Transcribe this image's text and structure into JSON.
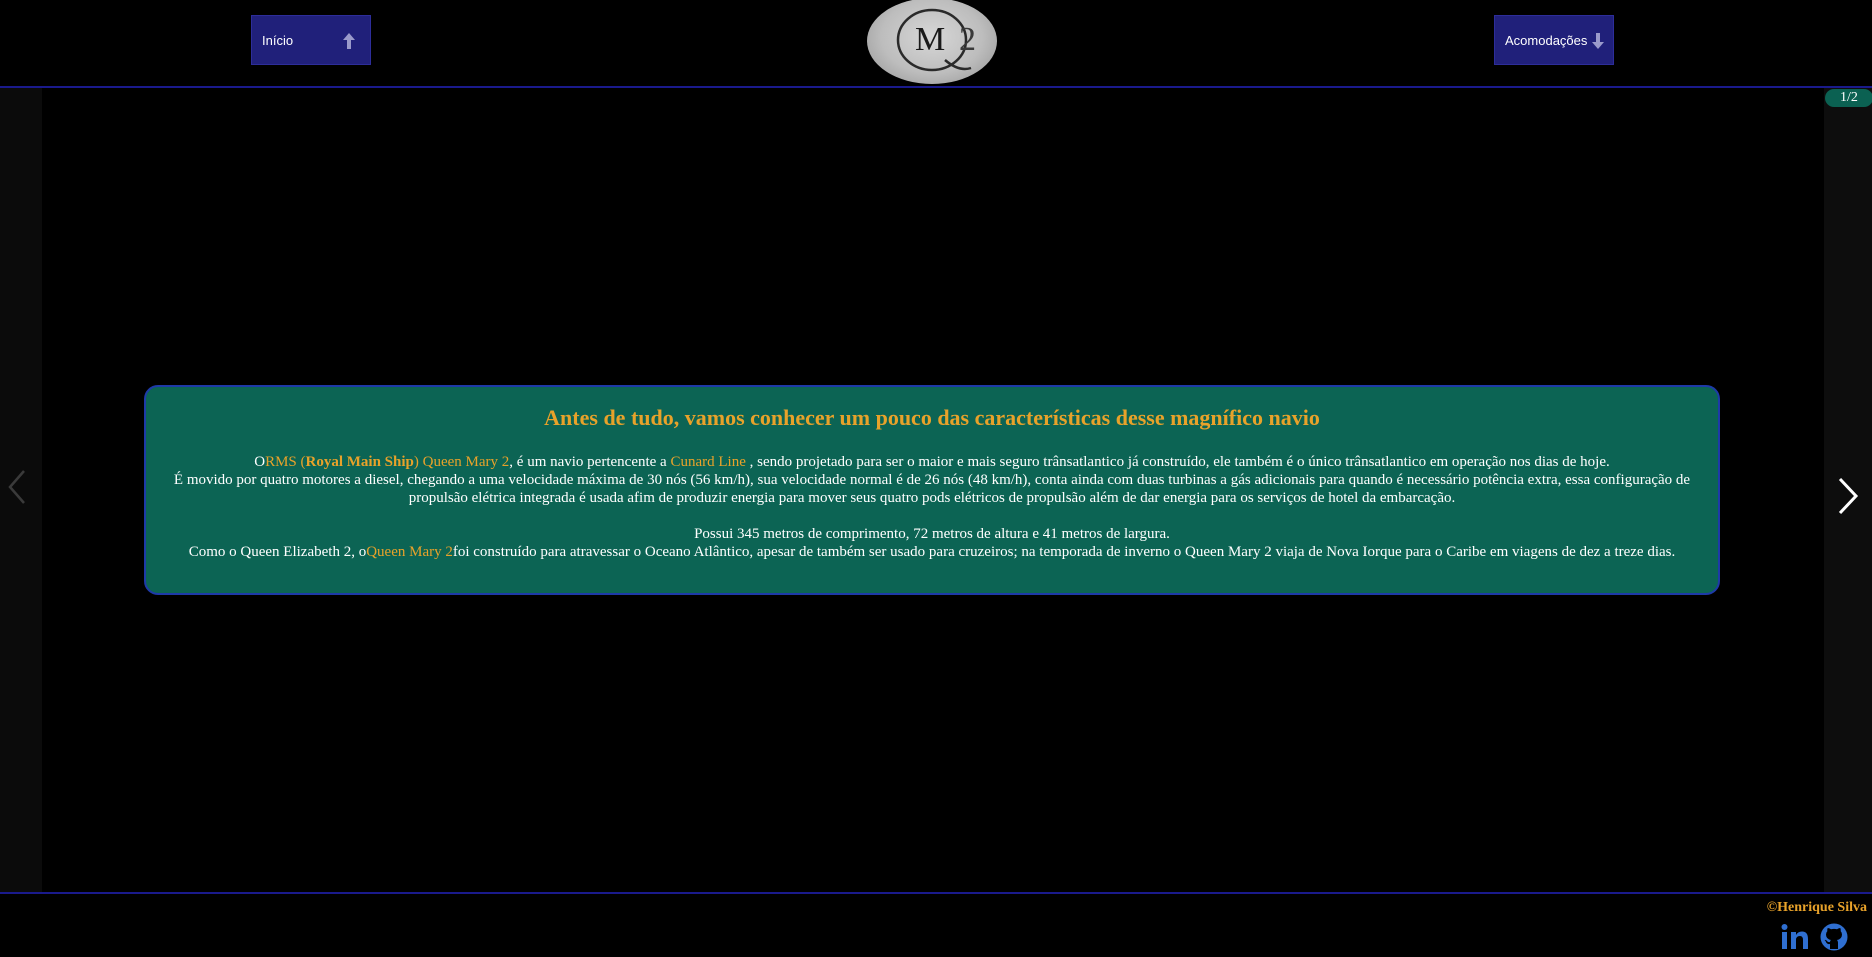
{
  "header": {
    "left_button_label": "Início",
    "right_button_label": "Acomodações",
    "logo_text_left": "M",
    "logo_text_right": "2"
  },
  "slider": {
    "counter": "1/2",
    "card": {
      "title": "Antes de tudo, vamos conhecer um pouco das características desse magnífico navio",
      "p1_prefix": "O",
      "p1_link1_a": "RMS (",
      "p1_link1_bold": "Royal Main Ship",
      "p1_link1_b": ") Queen Mary 2",
      "p1_mid": ", é um navio pertencente a ",
      "p1_link2": "Cunard Line",
      "p1_suffix": " , sendo projetado para ser o maior e mais seguro trânsatlantico já construído, ele também é o único trânsatlantico em operação nos dias de hoje.",
      "p2": "É movido por quatro motores a diesel, chegando a uma velocidade máxima de 30 nós (56 km/h), sua velocidade normal é de 26 nós (48 km/h), conta ainda com duas turbinas a gás adicionais para quando é necessário potência extra, essa configuração de propulsão elétrica integrada é usada afim de produzir energia para mover seus quatro pods elétricos de propulsão além de dar energia para os serviços de hotel da embarcação.",
      "p3": "Possui 345 metros de comprimento, 72 metros de altura e 41 metros de largura.",
      "p4_prefix": "Como o Queen Elizabeth 2, o",
      "p4_link": "Queen Mary 2",
      "p4_suffix": "foi construído para atravessar o Oceano Atlântico, apesar de também ser usado para cruzeiros; na temporada de inverno o Queen Mary 2 viaja de Nova Iorque para o Caribe em viagens de dez a treze dias."
    }
  },
  "footer": {
    "copyright": "©Henrique Silva"
  },
  "colors": {
    "accent_gold": "#e8a22a",
    "card_green": "#0c6454",
    "nav_blue": "#20207a",
    "border_blue": "#1a1a8c"
  },
  "icons": {
    "left_button": "arrow-up-icon",
    "right_button": "arrow-down-icon",
    "prev": "chevron-left-icon",
    "next": "chevron-right-icon",
    "social1": "linkedin-icon",
    "social2": "github-icon"
  }
}
